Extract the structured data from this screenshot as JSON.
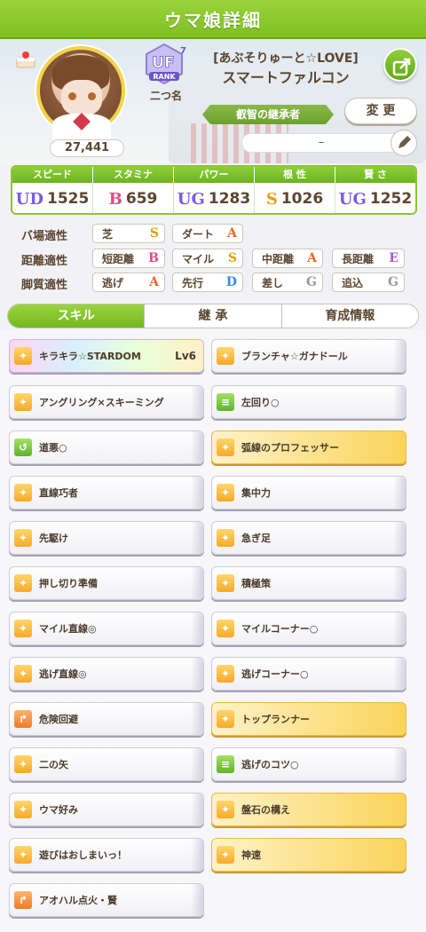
{
  "header": {
    "title": "ウマ娘詳細"
  },
  "profile": {
    "fans": "27,441",
    "rank_name": "二つ名",
    "rank_badge": "UF",
    "rank_sub": "RANK",
    "rank_tier": "7",
    "nickname": "[あぶそりゅーと☆LOVE]",
    "name": "スマートファルコン",
    "title_badge": "叡智の継承者",
    "change_button": "変 更",
    "memo": "–"
  },
  "stats": {
    "headers": [
      "スピード",
      "スタミナ",
      "パワー",
      "根 性",
      "賢 さ"
    ],
    "grades": [
      "UD",
      "B",
      "UG",
      "S",
      "UG"
    ],
    "values": [
      "1525",
      "659",
      "1283",
      "1026",
      "1252"
    ]
  },
  "aptitudes": {
    "track_label": "バ場適性",
    "distance_label": "距離適性",
    "strategy_label": "脚質適性",
    "track": [
      {
        "name": "芝",
        "grade": "S"
      },
      {
        "name": "ダート",
        "grade": "A"
      }
    ],
    "distance": [
      {
        "name": "短距離",
        "grade": "B"
      },
      {
        "name": "マイル",
        "grade": "S"
      },
      {
        "name": "中距離",
        "grade": "A"
      },
      {
        "name": "長距離",
        "grade": "E"
      }
    ],
    "strategy": [
      {
        "name": "逃げ",
        "grade": "A"
      },
      {
        "name": "先行",
        "grade": "D"
      },
      {
        "name": "差し",
        "grade": "G"
      },
      {
        "name": "追込",
        "grade": "G"
      }
    ]
  },
  "tabs": [
    "スキル",
    "継 承",
    "育成情報"
  ],
  "skills": [
    {
      "name": "キラキラ☆STARDOM",
      "level": "Lv6"
    },
    {
      "name": "ブランチャ☆ガナドール"
    },
    {
      "name": "アングリング×スキーミング"
    },
    {
      "name": "左回り○"
    },
    {
      "name": "道悪○"
    },
    {
      "name": "弧線のプロフェッサー"
    },
    {
      "name": "直線巧者"
    },
    {
      "name": "集中力"
    },
    {
      "name": "先駆け"
    },
    {
      "name": "急ぎ足"
    },
    {
      "name": "押し切り準備"
    },
    {
      "name": "積極策"
    },
    {
      "name": "マイル直線◎"
    },
    {
      "name": "マイルコーナー○"
    },
    {
      "name": "逃げ直線◎"
    },
    {
      "name": "逃げコーナー○"
    },
    {
      "name": "危険回避"
    },
    {
      "name": "トップランナー"
    },
    {
      "name": "二の矢"
    },
    {
      "name": "逃げのコツ○"
    },
    {
      "name": "ウマ好み"
    },
    {
      "name": "盤石の構え"
    },
    {
      "name": "遊びはおしまいっ！"
    },
    {
      "name": "神速"
    },
    {
      "name": "アオハル点火・賢"
    }
  ],
  "colors": {
    "accent": "#7fbf22",
    "gold_skill": "#f9d45a"
  }
}
